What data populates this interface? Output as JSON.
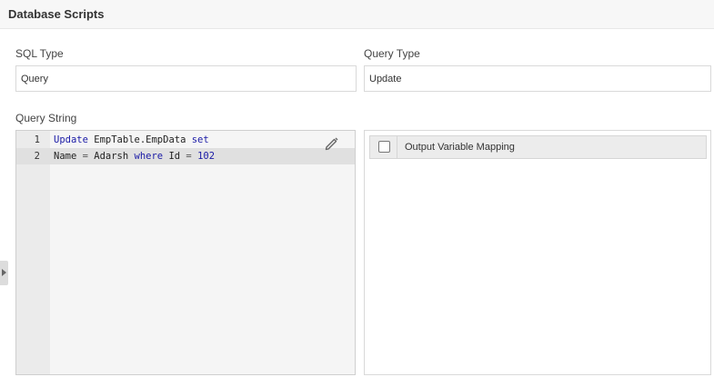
{
  "header": {
    "title": "Database Scripts"
  },
  "sql_type": {
    "label": "SQL Type",
    "value": "Query"
  },
  "query_type": {
    "label": "Query Type",
    "value": "Update"
  },
  "query_string": {
    "label": "Query String",
    "lines": [
      {
        "number": "1",
        "tokens": [
          {
            "text": "Update",
            "kind": "kw"
          },
          {
            "text": " EmpTable.EmpData ",
            "kind": "plain"
          },
          {
            "text": "set",
            "kind": "kw"
          }
        ]
      },
      {
        "number": "2",
        "tokens": [
          {
            "text": "Name ",
            "kind": "plain"
          },
          {
            "text": "=",
            "kind": "op"
          },
          {
            "text": " Adarsh ",
            "kind": "plain"
          },
          {
            "text": "where",
            "kind": "kw"
          },
          {
            "text": " Id ",
            "kind": "plain"
          },
          {
            "text": "=",
            "kind": "op"
          },
          {
            "text": " ",
            "kind": "plain"
          },
          {
            "text": "102",
            "kind": "num"
          }
        ]
      }
    ],
    "edit_icon": "pencil-icon"
  },
  "output_mapping": {
    "header_label": "Output Variable Mapping",
    "select_all_checked": false
  },
  "side_tab": {
    "icon": "chevron-right-icon"
  }
}
